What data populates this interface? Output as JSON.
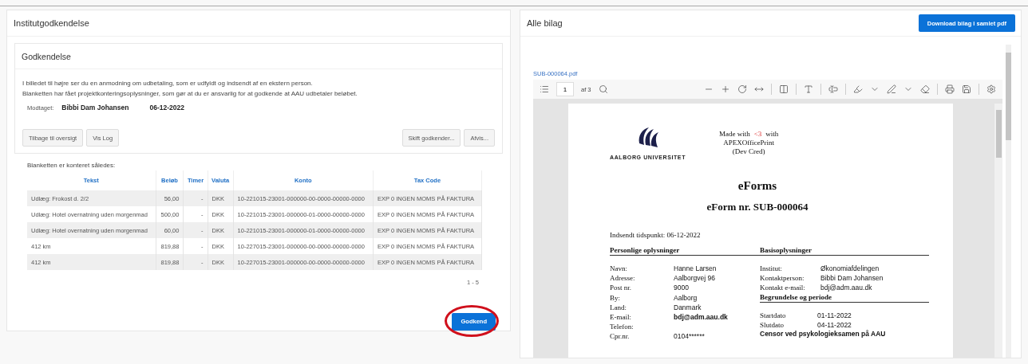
{
  "approval_panel": {
    "title": "Institutgodkendelse",
    "card": {
      "title": "Godkendelse",
      "description": [
        "I billedet til højre ser du en anmodning om udbetaling, som er udfyldt og indsendt af en ekstern person.",
        "Blanketten har fået projektkonteringsoplysninger, som gør at du er ansvarlig for at godkende at AAU udbetaler beløbet."
      ],
      "received_label": "Modtaget:",
      "received_name": "Bibbi Dam Johansen",
      "received_date": "06-12-2022",
      "left_buttons": [
        "Tilbage til oversigt",
        "Vis Log"
      ],
      "right_buttons": [
        "Skift godkender...",
        "Afvis..."
      ]
    },
    "table_caption": "Blanketten er konteret således:",
    "table": {
      "columns": [
        "Tekst",
        "Beløb",
        "Timer",
        "Valuta",
        "Konto",
        "Tax Code"
      ],
      "rows": [
        [
          "Udlæg: Frokost d. 2/2",
          "56,00",
          "-",
          "DKK",
          "10-221015-23001-000000-00-0000-00000-0000",
          "EXP 0 INGEN MOMS PÅ FAKTURA"
        ],
        [
          "Udlæg: Hotel overnatning uden morgenmad",
          "500,00",
          "-",
          "DKK",
          "10-221015-23001-000000-01-0000-00000-0000",
          "EXP 0 INGEN MOMS PÅ FAKTURA"
        ],
        [
          "Udlæg: Hotel overnatning uden morgenmad",
          "60,00",
          "-",
          "DKK",
          "10-221015-23001-000000-01-0000-00000-0000",
          "EXP 0 INGEN MOMS PÅ FAKTURA"
        ],
        [
          "412 km",
          "819,88",
          "-",
          "DKK",
          "10-227015-23001-000000-00-0000-00000-0000",
          "EXP 0 INGEN MOMS PÅ FAKTURA"
        ],
        [
          "412 km",
          "819,88",
          "-",
          "DKK",
          "10-227015-23001-000000-00-0000-00000-0000",
          "EXP 0 INGEN MOMS PÅ FAKTURA"
        ]
      ],
      "pagination": "1 - 5"
    },
    "approve_button": "Godkend"
  },
  "attachments_panel": {
    "title": "Alle bilag",
    "download_button": "Download bilag i samlet pdf",
    "file_link": "SUB-000064.pdf",
    "viewer": {
      "page_number": "1",
      "page_count": "af 3",
      "document": {
        "logo_text": "AALBORG UNIVERSITET",
        "made_with": [
          "Made with",
          "<3",
          "with"
        ],
        "made_with_lines": [
          "APEXOfficePrint",
          "(Dev  Cred)"
        ],
        "title": "eForms",
        "subtitle": "eForm nr. SUB-000064",
        "submitted": "Indsendt tidspunkt: 06-12-2022",
        "left_section": {
          "heading": "Personlige oplysninger",
          "fields": [
            {
              "label": "Navn:",
              "value": "Hanne Larsen",
              "bold": false
            },
            {
              "label": "Adresse:",
              "value": "Aalborgvej 96",
              "bold": false
            },
            {
              "label": "Post nr.",
              "value": "9000",
              "bold": false
            },
            {
              "label": "By:",
              "value": "Aalborg",
              "bold": false
            },
            {
              "label": "Land:",
              "value": "Danmark",
              "bold": false
            },
            {
              "label": "E-mail:",
              "value": "bdj@adm.aau.dk",
              "bold": true
            },
            {
              "label": "Telefon:"
            },
            {
              "label": "Cpr.nr.",
              "value": "0104******",
              "bold": false
            }
          ]
        },
        "right_section": {
          "heading": "Basisoplysninger",
          "fields": [
            {
              "label": "Institut:",
              "value": "Økonomiafdelingen"
            },
            {
              "label": "Kontaktperson:",
              "value": "Bibbi Dam Johansen"
            },
            {
              "label": "Kontakt e-mail:",
              "value": "bdj@adm.aau.dk"
            }
          ],
          "heading_2": "Begrundelse og periode",
          "fields_2": [
            {
              "label": "Startdato",
              "value": "01-11-2022"
            },
            {
              "label": "Slutdato",
              "value": "04-11-2022"
            }
          ],
          "reason": "Censor ved psykologieksamen på AAU"
        }
      }
    }
  }
}
